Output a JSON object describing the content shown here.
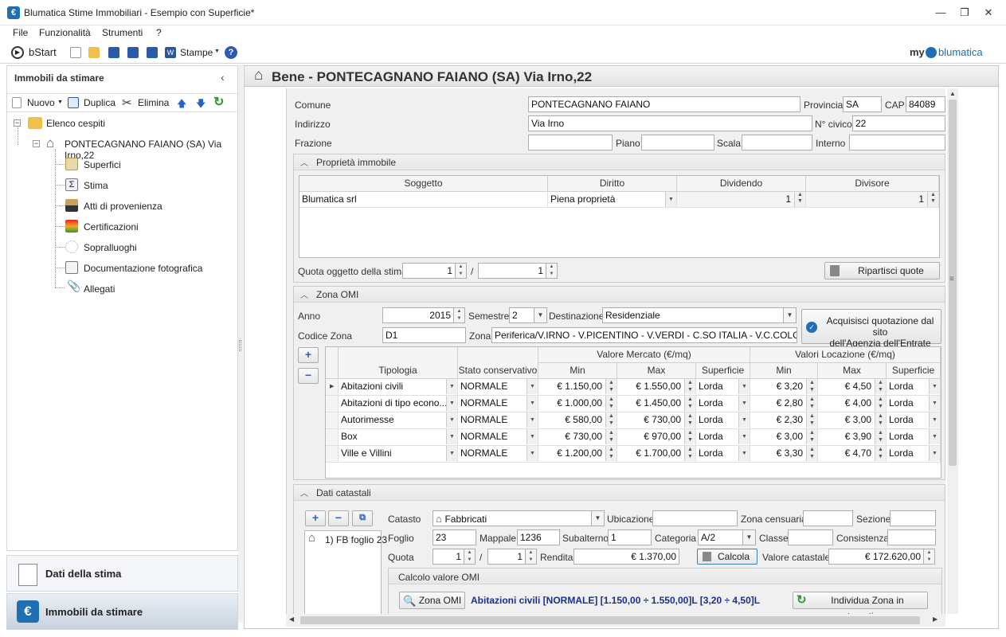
{
  "window": {
    "title": "Blumatica Stime Immobiliari - Esempio con Superficie*"
  },
  "menu": [
    "File",
    "Funzionalità",
    "Strumenti",
    "?"
  ],
  "toolbar": {
    "bstart": "bStart",
    "stampe": "Stampe",
    "brand_my": "my",
    "brand_name": "blumatica"
  },
  "left": {
    "title": "Immobili da stimare",
    "tools": {
      "nuovo": "Nuovo",
      "duplica": "Duplica",
      "elimina": "Elimina"
    },
    "tree": {
      "root": "Elenco cespiti",
      "bene": "PONTECAGNANO FAIANO (SA) Via Irno,22",
      "children": [
        "Superfici",
        "Stima",
        "Atti di provenienza",
        "Certificazioni",
        "Sopralluoghi",
        "Documentazione fotografica",
        "Allegati"
      ]
    },
    "nav": [
      "Dati della stima",
      "Immobili da stimare"
    ]
  },
  "header": {
    "title": "Bene - PONTECAGNANO FAIANO (SA) Via Irno,22"
  },
  "anag": {
    "comune_l": "Comune",
    "comune": "PONTECAGNANO FAIANO",
    "provincia_l": "Provincia",
    "provincia": "SA",
    "cap_l": "CAP",
    "cap": "84089",
    "indirizzo_l": "Indirizzo",
    "indirizzo": "Via Irno",
    "civico_l": "N° civico",
    "civico": "22",
    "frazione_l": "Frazione",
    "piano_l": "Piano",
    "scala_l": "Scala",
    "interno_l": "Interno"
  },
  "proprieta": {
    "title": "Proprietà immobile",
    "cols": [
      "Soggetto",
      "Diritto",
      "Dividendo",
      "Divisore"
    ],
    "row": {
      "soggetto": "Blumatica srl",
      "diritto": "Piena proprietà",
      "dividendo": "1",
      "divisore": "1"
    },
    "quota_l": "Quota oggetto della stima",
    "quota_a": "1",
    "quota_b": "1",
    "ripartisci": "Ripartisci quote"
  },
  "omi": {
    "title": "Zona OMI",
    "anno_l": "Anno",
    "anno": "2015",
    "semestre_l": "Semestre",
    "semestre": "2",
    "dest_l": "Destinazione",
    "dest": "Residenziale",
    "acquisisci": [
      "Acquisisci quotazione dal sito",
      "dell'Agenzia dell'Entrate"
    ],
    "codice_l": "Codice Zona",
    "codice": "D1",
    "zona_l": "Zona",
    "zona": "Periferica/V.IRNO - V.PICENTINO - V.VERDI - C.SO ITALIA - V.C.COLOMBO - V",
    "group_mercato": "Valore Mercato (€/mq)",
    "group_locazione": "Valori Locazione (€/mq)",
    "cols": [
      "Tipologia",
      "Stato conservativo",
      "Min",
      "Max",
      "Superficie",
      "Min",
      "Max",
      "Superficie"
    ],
    "rows": [
      {
        "tip": "Abitazioni civili",
        "stato": "NORMALE",
        "vmin": "€ 1.150,00",
        "vmax": "€ 1.550,00",
        "sup": "Lorda",
        "lmin": "€ 3,20",
        "lmax": "€ 4,50",
        "lsup": "Lorda"
      },
      {
        "tip": "Abitazioni di tipo econo...",
        "stato": "NORMALE",
        "vmin": "€ 1.000,00",
        "vmax": "€ 1.450,00",
        "sup": "Lorda",
        "lmin": "€ 2,80",
        "lmax": "€ 4,00",
        "lsup": "Lorda"
      },
      {
        "tip": "Autorimesse",
        "stato": "NORMALE",
        "vmin": "€ 580,00",
        "vmax": "€ 730,00",
        "sup": "Lorda",
        "lmin": "€ 2,30",
        "lmax": "€ 3,00",
        "lsup": "Lorda"
      },
      {
        "tip": "Box",
        "stato": "NORMALE",
        "vmin": "€ 730,00",
        "vmax": "€ 970,00",
        "sup": "Lorda",
        "lmin": "€ 3,00",
        "lmax": "€ 3,90",
        "lsup": "Lorda"
      },
      {
        "tip": "Ville e Villini",
        "stato": "NORMALE",
        "vmin": "€ 1.200,00",
        "vmax": "€ 1.700,00",
        "sup": "Lorda",
        "lmin": "€ 3,30",
        "lmax": "€ 4,70",
        "lsup": "Lorda"
      }
    ]
  },
  "catasto": {
    "title": "Dati catastali",
    "item": "1) FB foglio 23",
    "catasto_l": "Catasto",
    "catasto": "Fabbricati",
    "ubicazione_l": "Ubicazione",
    "zona_cens_l": "Zona censuaria",
    "sezione_l": "Sezione",
    "foglio_l": "Foglio",
    "foglio": "23",
    "mappale_l": "Mappale",
    "mappale": "1236",
    "subalterno_l": "Subalterno",
    "subalterno": "1",
    "categoria_l": "Categoria",
    "categoria": "A/2",
    "classe_l": "Classe",
    "consistenza_l": "Consistenza",
    "quota_l": "Quota",
    "quota_a": "1",
    "quota_b": "1",
    "rendita_l": "Rendita",
    "rendita": "€ 1.370,00",
    "calcola": "Calcola",
    "valore_l": "Valore catastale",
    "valore": "€ 172.620,00",
    "calc_title": "Calcolo valore OMI",
    "zona_omi_btn": "Zona OMI",
    "calc_text": "Abitazioni civili [NORMALE] [1.150,00 ÷ 1.550,00]L [3,20 ÷ 4,50]L",
    "individua": "Individua Zona in automatico"
  }
}
